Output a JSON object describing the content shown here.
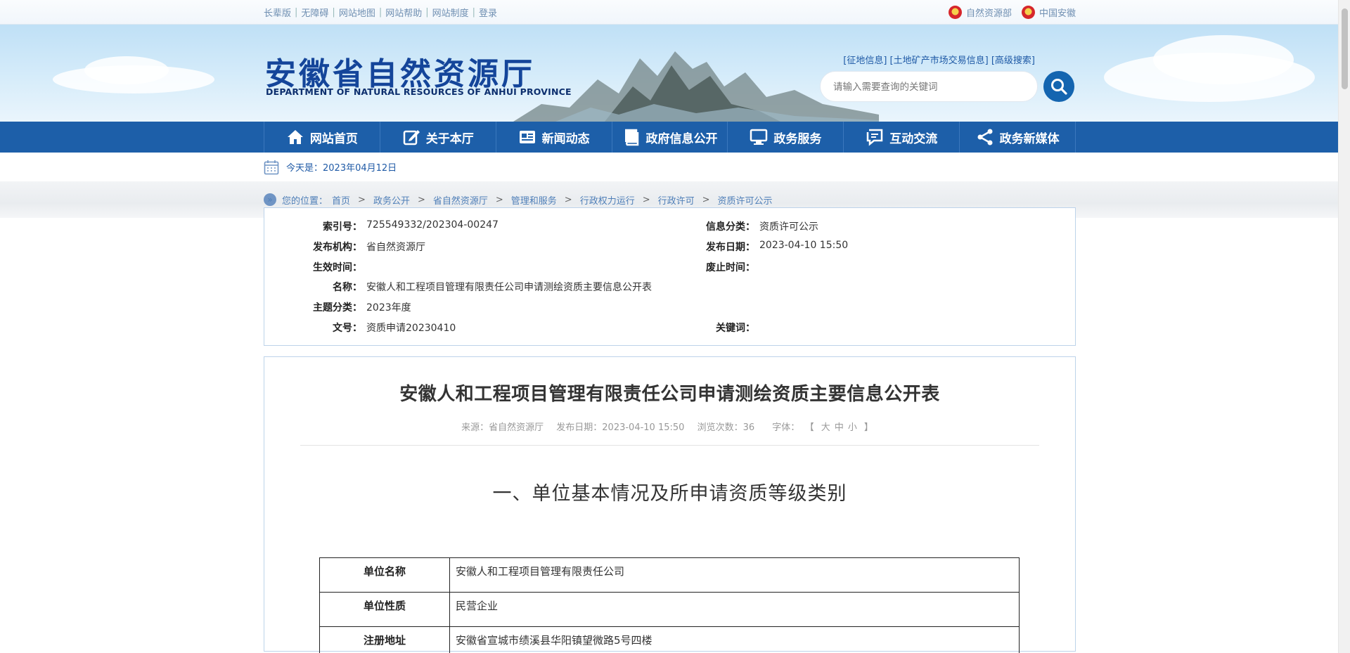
{
  "topbar": {
    "links": [
      "长辈版",
      "无障碍",
      "网站地图",
      "网站帮助",
      "网站制度",
      "登录"
    ],
    "right": [
      "自然资源部",
      "中国安徽"
    ]
  },
  "header": {
    "title_cn": "安徽省自然资源厅",
    "title_en": "DEPARTMENT OF NATURAL RESOURCES OF ANHUI PROVINCE",
    "quicklinks": [
      "[征地信息]",
      "[土地矿产市场交易信息]",
      "[高级搜索]"
    ],
    "search_placeholder": "请输入需要查询的关键词"
  },
  "nav": {
    "items": [
      {
        "label": "网站首页",
        "icon": "home-icon"
      },
      {
        "label": "关于本厅",
        "icon": "edit-icon"
      },
      {
        "label": "新闻动态",
        "icon": "news-icon"
      },
      {
        "label": "政府信息公开",
        "icon": "book-icon"
      },
      {
        "label": "政务服务",
        "icon": "monitor-icon"
      },
      {
        "label": "互动交流",
        "icon": "chat-icon"
      },
      {
        "label": "政务新媒体",
        "icon": "share-icon"
      }
    ]
  },
  "date": {
    "text": "今天是：2023年04月12日"
  },
  "breadcrumb": {
    "prefix": "您的位置：",
    "items": [
      "首页",
      "政务公开",
      "省自然资源厅",
      "管理和服务",
      "行政权力运行",
      "行政许可",
      "资质许可公示"
    ]
  },
  "info": {
    "index_k": "索引号：",
    "index_v": "725549332/202304-00247",
    "category_k": "信息分类：",
    "category_v": "资质许可公示",
    "publisher_k": "发布机构：",
    "publisher_v": "省自然资源厅",
    "pubdate_k": "发布日期：",
    "pubdate_v": "2023-04-10 15:50",
    "effective_k": "生效时间：",
    "effective_v": "",
    "expire_k": "废止时间：",
    "expire_v": "",
    "name_k": "名称：",
    "name_v": "安徽人和工程项目管理有限责任公司申请测绘资质主要信息公开表",
    "theme_k": "主题分类：",
    "theme_v": "2023年度",
    "docno_k": "文号：",
    "docno_v": "资质申请20230410",
    "keywords_k": "关键词：",
    "keywords_v": ""
  },
  "article": {
    "title": "安徽人和工程项目管理有限责任公司申请测绘资质主要信息公开表",
    "source": "来源：省自然资源厅",
    "pubdate": "发布日期：2023-04-10 15:50",
    "views": "浏览次数：36",
    "fontsize_label": "字体：",
    "fontsize_open": "【",
    "fontsize_options": [
      "大",
      "中",
      "小"
    ],
    "fontsize_close": "】",
    "section_heading": "一、单位基本情况及所申请资质等级类别",
    "table": [
      {
        "k": "单位名称",
        "v": "安徽人和工程项目管理有限责任公司"
      },
      {
        "k": "单位性质",
        "v": "民营企业"
      },
      {
        "k": "注册地址",
        "v": "安徽省宣城市绩溪县华阳镇望微路5号四楼"
      }
    ]
  }
}
